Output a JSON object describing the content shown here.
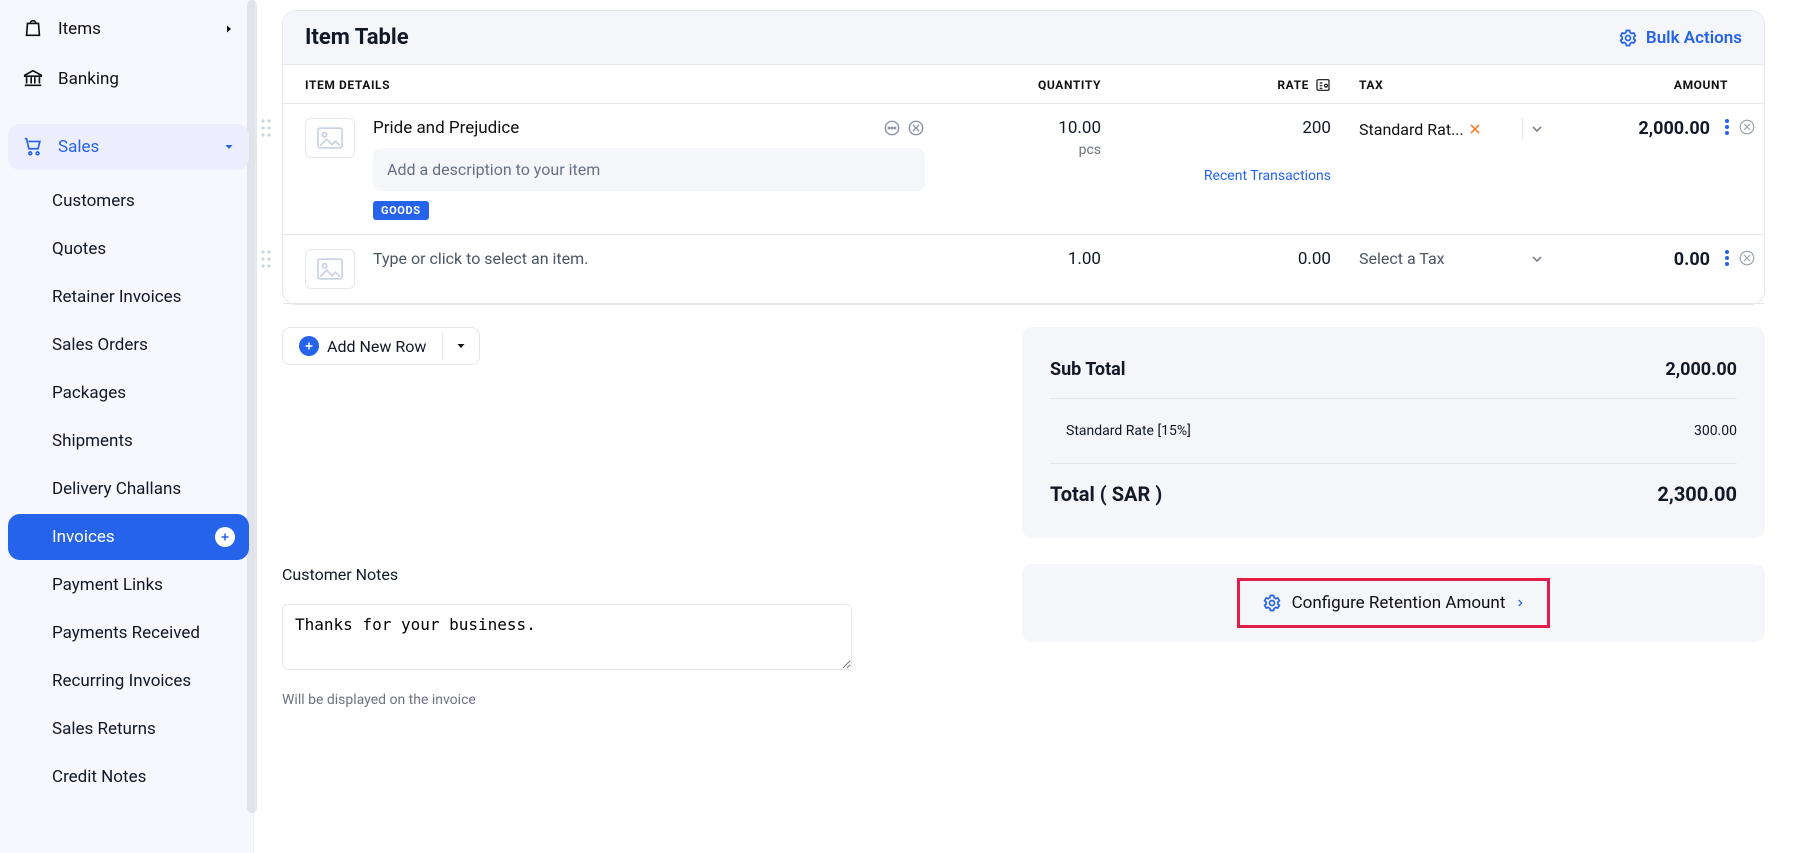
{
  "sidebar": {
    "top": [
      {
        "icon": "shopping-bag-icon",
        "label": "Items",
        "chev": "right"
      },
      {
        "icon": "bank-icon",
        "label": "Banking"
      }
    ],
    "salesLabel": "Sales",
    "sub": [
      "Customers",
      "Quotes",
      "Retainer Invoices",
      "Sales Orders",
      "Packages",
      "Shipments",
      "Delivery Challans",
      "Invoices",
      "Payment Links",
      "Payments Received",
      "Recurring Invoices",
      "Sales Returns",
      "Credit Notes"
    ],
    "activeSub": "Invoices"
  },
  "tableHeader": {
    "title": "Item Table",
    "bulk": "Bulk Actions"
  },
  "columns": {
    "item": "ITEM DETAILS",
    "qty": "QUANTITY",
    "rate": "RATE",
    "tax": "TAX",
    "amount": "AMOUNT"
  },
  "rows": [
    {
      "name": "Pride and Prejudice",
      "descPlaceholder": "Add a description to your item",
      "badge": "GOODS",
      "qty": "10.00",
      "qtyUnit": "pcs",
      "rate": "200",
      "recent": "Recent Transactions",
      "tax": "Standard Rat...",
      "taxClear": true,
      "amount": "2,000.00"
    },
    {
      "namePlaceholder": "Type or click to select an item.",
      "qty": "1.00",
      "rate": "0.00",
      "taxPlaceholder": "Select a Tax",
      "amount": "0.00"
    }
  ],
  "addRow": "Add New Row",
  "notesLabel": "Customer Notes",
  "notesValue": "Thanks for your business.",
  "notesHint": "Will be displayed on the invoice",
  "totals": {
    "subtotalLabel": "Sub Total",
    "subtotal": "2,000.00",
    "taxLabel": "Standard Rate [15%]",
    "taxValue": "300.00",
    "totalLabel": "Total ( SAR )",
    "total": "2,300.00"
  },
  "retain": "Configure Retention Amount"
}
